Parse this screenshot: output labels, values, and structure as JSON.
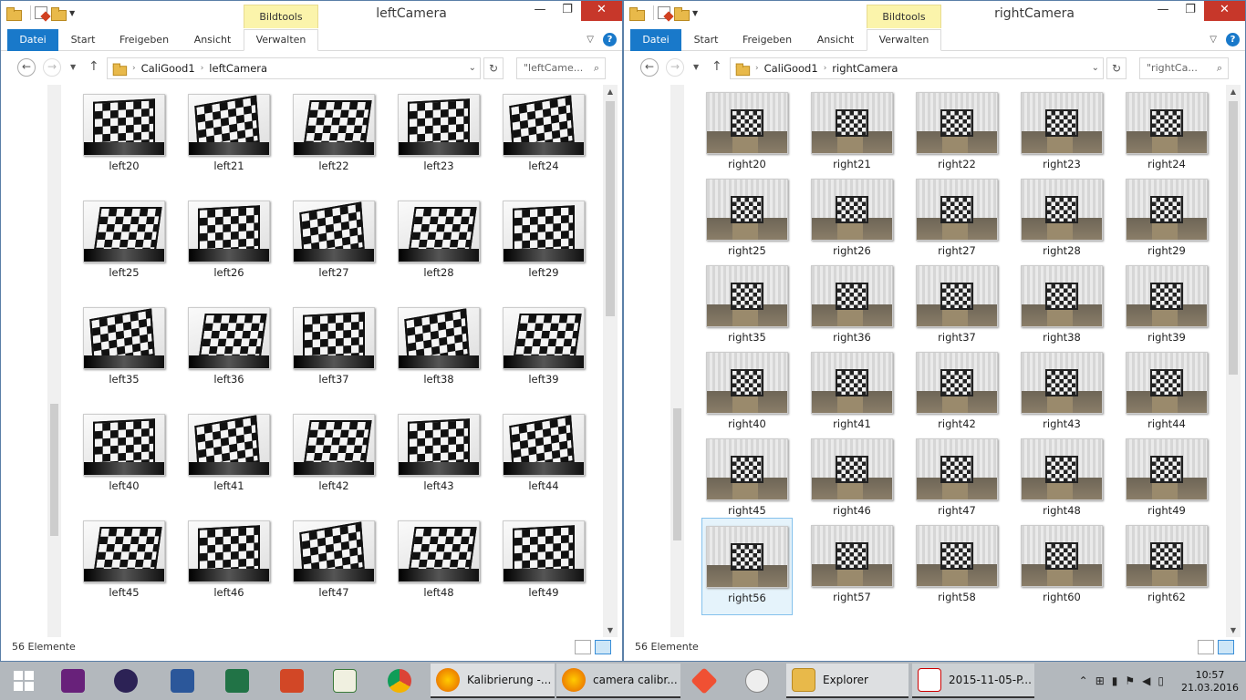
{
  "left": {
    "title": "leftCamera",
    "context_tab": "Bildtools",
    "ribbon_tabs": [
      "Datei",
      "Start",
      "Freigeben",
      "Ansicht",
      "Verwalten"
    ],
    "path": [
      "CaliGood1",
      "leftCamera"
    ],
    "search": "\"leftCame...",
    "status": "56 Elemente",
    "files": [
      "left20",
      "left21",
      "left22",
      "left23",
      "left24",
      "left25",
      "left26",
      "left27",
      "left28",
      "left29",
      "left35",
      "left36",
      "left37",
      "left38",
      "left39",
      "left40",
      "left41",
      "left42",
      "left43",
      "left44",
      "left45",
      "left46",
      "left47",
      "left48",
      "left49"
    ]
  },
  "right": {
    "title": "rightCamera",
    "context_tab": "Bildtools",
    "ribbon_tabs": [
      "Datei",
      "Start",
      "Freigeben",
      "Ansicht",
      "Verwalten"
    ],
    "path": [
      "CaliGood1",
      "rightCamera"
    ],
    "search": "\"rightCa...",
    "status": "56 Elemente",
    "selected": "right56",
    "files": [
      "right20",
      "right21",
      "right22",
      "right23",
      "right24",
      "right25",
      "right26",
      "right27",
      "right28",
      "right29",
      "right35",
      "right36",
      "right37",
      "right38",
      "right39",
      "right40",
      "right41",
      "right42",
      "right43",
      "right44",
      "right45",
      "right46",
      "right47",
      "right48",
      "right49",
      "right56",
      "right57",
      "right58",
      "right60",
      "right62"
    ]
  },
  "taskbar": {
    "buttons": [
      "Kalibrierung -...",
      "camera calibr...",
      "Explorer",
      "2015-11-05-P..."
    ],
    "time": "10:57",
    "date": "21.03.2016",
    "colors": {
      "vs": "#68217a",
      "word": "#2b579a",
      "excel": "#217346",
      "ppt": "#d24726",
      "chrome": "#4285f4",
      "firefox": "#e66000"
    }
  }
}
